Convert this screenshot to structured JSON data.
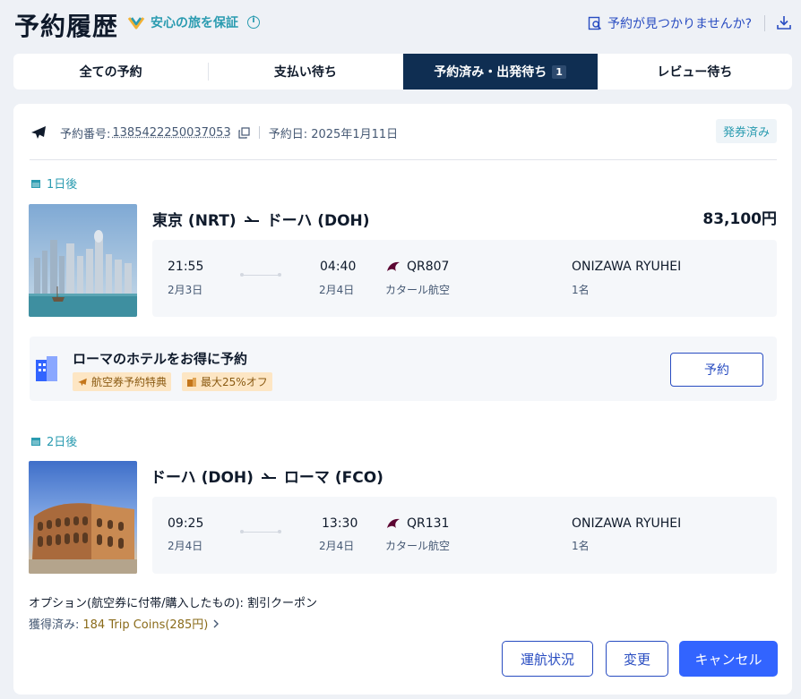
{
  "header": {
    "title": "予約履歴",
    "assurance": "安心の旅を保証",
    "not_found": "予約が見つかりませんか?"
  },
  "tabs": [
    {
      "label": "全ての予約",
      "count": ""
    },
    {
      "label": "支払い待ち",
      "count": ""
    },
    {
      "label": "予約済み・出発待ち",
      "count": "1"
    },
    {
      "label": "レビュー待ち",
      "count": ""
    }
  ],
  "booking": {
    "order_label": "予約番号:",
    "order_number": "1385422250037053",
    "order_date": "予約日: 2025年1月11日",
    "status": "発券済み",
    "price": "83,100円"
  },
  "segments": [
    {
      "days_tag": "1日後",
      "route_from": "東京 (NRT)",
      "route_to": "ドーハ (DOH)",
      "dep_time": "21:55",
      "dep_date": "2月3日",
      "arr_time": "04:40",
      "arr_date": "2月4日",
      "flight_no": "QR807",
      "airline": "カタール航空",
      "passenger": "ONIZAWA RYUHEI",
      "pax_count": "1名"
    },
    {
      "days_tag": "2日後",
      "route_from": "ドーハ (DOH)",
      "route_to": "ローマ (FCO)",
      "dep_time": "09:25",
      "dep_date": "2月4日",
      "arr_time": "13:30",
      "arr_date": "2月4日",
      "flight_no": "QR131",
      "airline": "カタール航空",
      "passenger": "ONIZAWA RYUHEI",
      "pax_count": "1名"
    }
  ],
  "promo": {
    "title": "ローマのホテルをお得に予約",
    "badge1": "航空券予約特典",
    "badge2": "最大25%オフ",
    "button": "予約"
  },
  "extras": {
    "option_line": "オプション(航空券に付帯/購入したもの): 割引クーポン",
    "coins_label": "獲得済み:",
    "coins_value": "184 Trip Coins(285円)"
  },
  "actions": {
    "status": "運航状況",
    "change": "変更",
    "cancel": "キャンセル"
  },
  "colors": {
    "accent": "#3264ff",
    "teal": "#2a9bb0",
    "navy": "#0f2e52"
  }
}
